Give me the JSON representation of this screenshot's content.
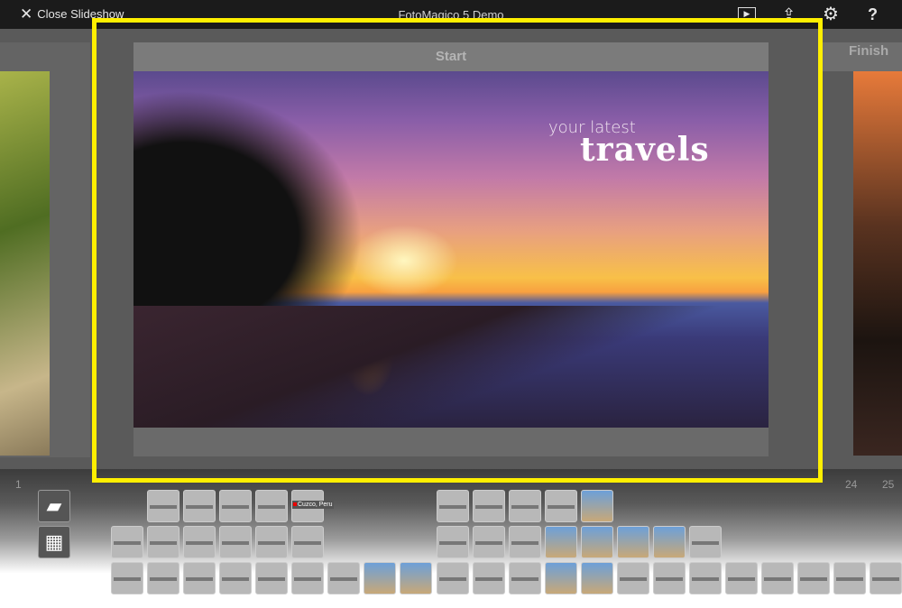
{
  "topbar": {
    "close_label": "Close Slideshow",
    "title": "FotoMagico 5 Demo",
    "icons": [
      "play-icon",
      "share-icon",
      "gear-icon",
      "help-icon"
    ],
    "help": "?"
  },
  "stage": {
    "current_slide_label": "Start",
    "next_slide_label": "Finish",
    "caption_line1": "your latest",
    "caption_line2": "travels"
  },
  "timeline": {
    "numbers": [
      {
        "n": "1"
      },
      {
        "n": "24"
      },
      {
        "n": "25"
      }
    ],
    "track_icons": [
      "slide-icon",
      "film-icon"
    ],
    "title_label": "Cuzco, Peru"
  },
  "colors": {
    "highlight": "#ffef00",
    "topbar": "#1b1b1b"
  }
}
